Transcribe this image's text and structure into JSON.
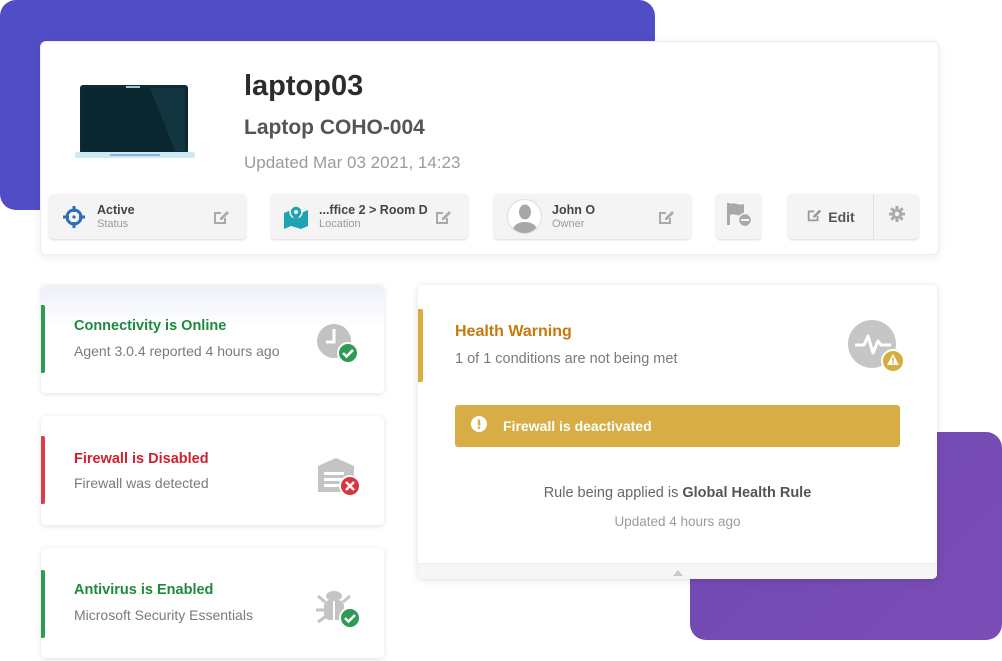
{
  "device": {
    "name": "laptop03",
    "model": "Laptop COHO-004",
    "updated": "Updated Mar 03 2021, 14:23"
  },
  "chips": {
    "status": {
      "value": "Active",
      "label": "Status"
    },
    "location": {
      "value": "...ffice 2 > Room D",
      "label": "Location"
    },
    "owner": {
      "value": "John O",
      "label": "Owner"
    },
    "edit_label": "Edit"
  },
  "status_cards": [
    {
      "title": "Connectivity is Online",
      "desc": "Agent 3.0.4 reported 4 hours ago",
      "state": "ok"
    },
    {
      "title": "Firewall is Disabled",
      "desc": "Firewall was detected",
      "state": "error"
    },
    {
      "title": "Antivirus is Enabled",
      "desc": "Microsoft Security Essentials",
      "state": "ok"
    }
  ],
  "health": {
    "title": "Health Warning",
    "desc": "1 of 1 conditions are not being met",
    "alert": "Firewall is deactivated",
    "rule_prefix": "Rule being applied is",
    "rule_name": "Global Health Rule",
    "updated": "Updated 4 hours ago"
  },
  "colors": {
    "ok": "#1e8a3c",
    "error": "#d0202e",
    "warning": "#c8790c",
    "alert_bg": "#d8ad45",
    "brand_blue": "#514dc5",
    "brand_purple": "#7249b4"
  }
}
